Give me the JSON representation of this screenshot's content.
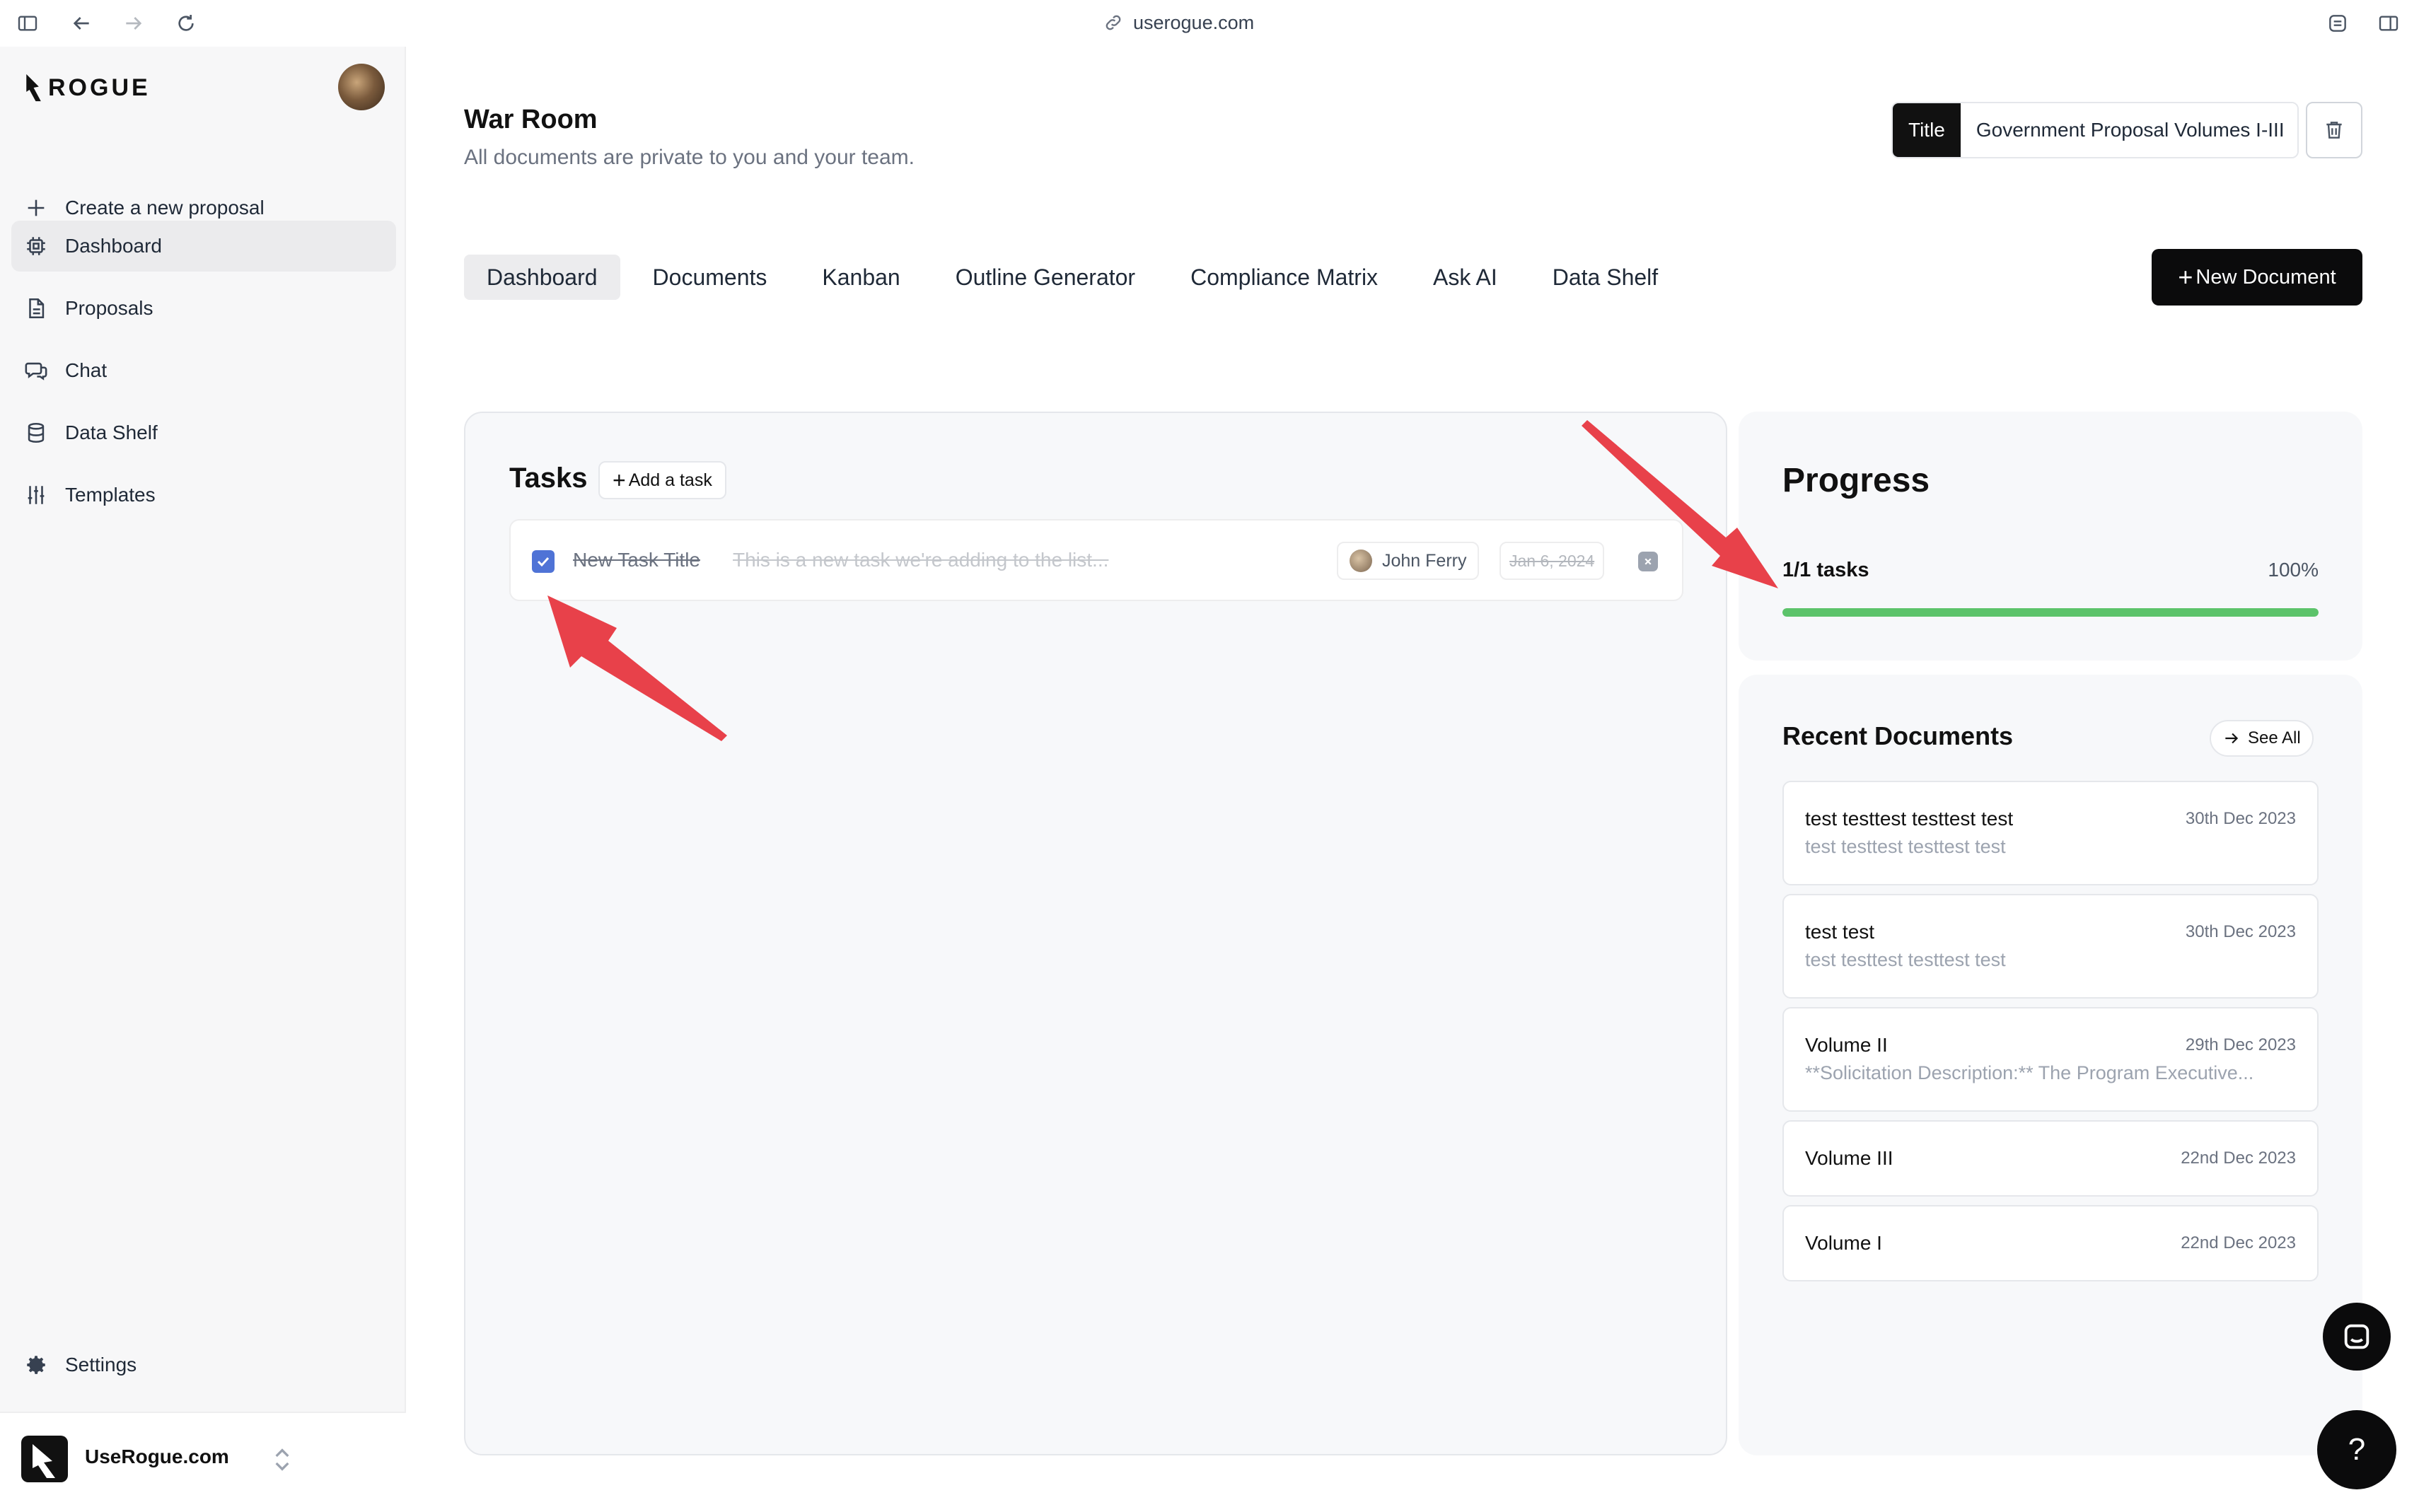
{
  "browser": {
    "url": "userogue.com"
  },
  "sidebar": {
    "logo_text": "ROGUE",
    "items": [
      {
        "label": "Create a new proposal",
        "icon": "plus-icon"
      },
      {
        "label": "Dashboard",
        "icon": "chip-icon",
        "active": true
      },
      {
        "label": "Proposals",
        "icon": "document-icon"
      },
      {
        "label": "Chat",
        "icon": "chat-bubbles-icon"
      },
      {
        "label": "Data Shelf",
        "icon": "database-icon"
      },
      {
        "label": "Templates",
        "icon": "sliders-icon"
      }
    ],
    "settings_label": "Settings",
    "org_name": "UseRogue.com"
  },
  "header": {
    "title": "War Room",
    "subtitle": "All documents are private to you and your team.",
    "title_field_tag": "Title",
    "title_field_value": "Government Proposal Volumes I-III"
  },
  "tabs": [
    {
      "label": "Dashboard",
      "active": true
    },
    {
      "label": "Documents"
    },
    {
      "label": "Kanban"
    },
    {
      "label": "Outline Generator"
    },
    {
      "label": "Compliance Matrix"
    },
    {
      "label": "Ask AI"
    },
    {
      "label": "Data Shelf"
    }
  ],
  "new_document_label": "New Document",
  "tasks": {
    "title": "Tasks",
    "add_label": "Add a task",
    "items": [
      {
        "title": "New Task Title",
        "description": "This is a new task we're adding to the list...",
        "assignee": "John Ferry",
        "due": "Jan 6, 2024",
        "done": true
      }
    ]
  },
  "progress": {
    "title": "Progress",
    "count_label": "1/1 tasks",
    "percent_label": "100%",
    "fraction": 1.0
  },
  "recent_documents": {
    "title": "Recent Documents",
    "see_all_label": "See All",
    "items": [
      {
        "name": "test testtest testtest test",
        "date": "30th Dec 2023",
        "preview": "test testtest testtest test"
      },
      {
        "name": "test test",
        "date": "30th Dec 2023",
        "preview": "test testtest testtest test"
      },
      {
        "name": "Volume II",
        "date": "29th Dec 2023",
        "preview": "**Solicitation Description:** The Program Executive..."
      },
      {
        "name": "Volume III",
        "date": "22nd Dec 2023",
        "preview": ""
      },
      {
        "name": "Volume I",
        "date": "22nd Dec 2023",
        "preview": ""
      }
    ]
  },
  "help_label": "?",
  "colors": {
    "accent": "#0b0b0c",
    "progress_fill": "#5cc36a",
    "checkbox": "#4f73d6",
    "annotation_arrow": "#e8414a"
  }
}
